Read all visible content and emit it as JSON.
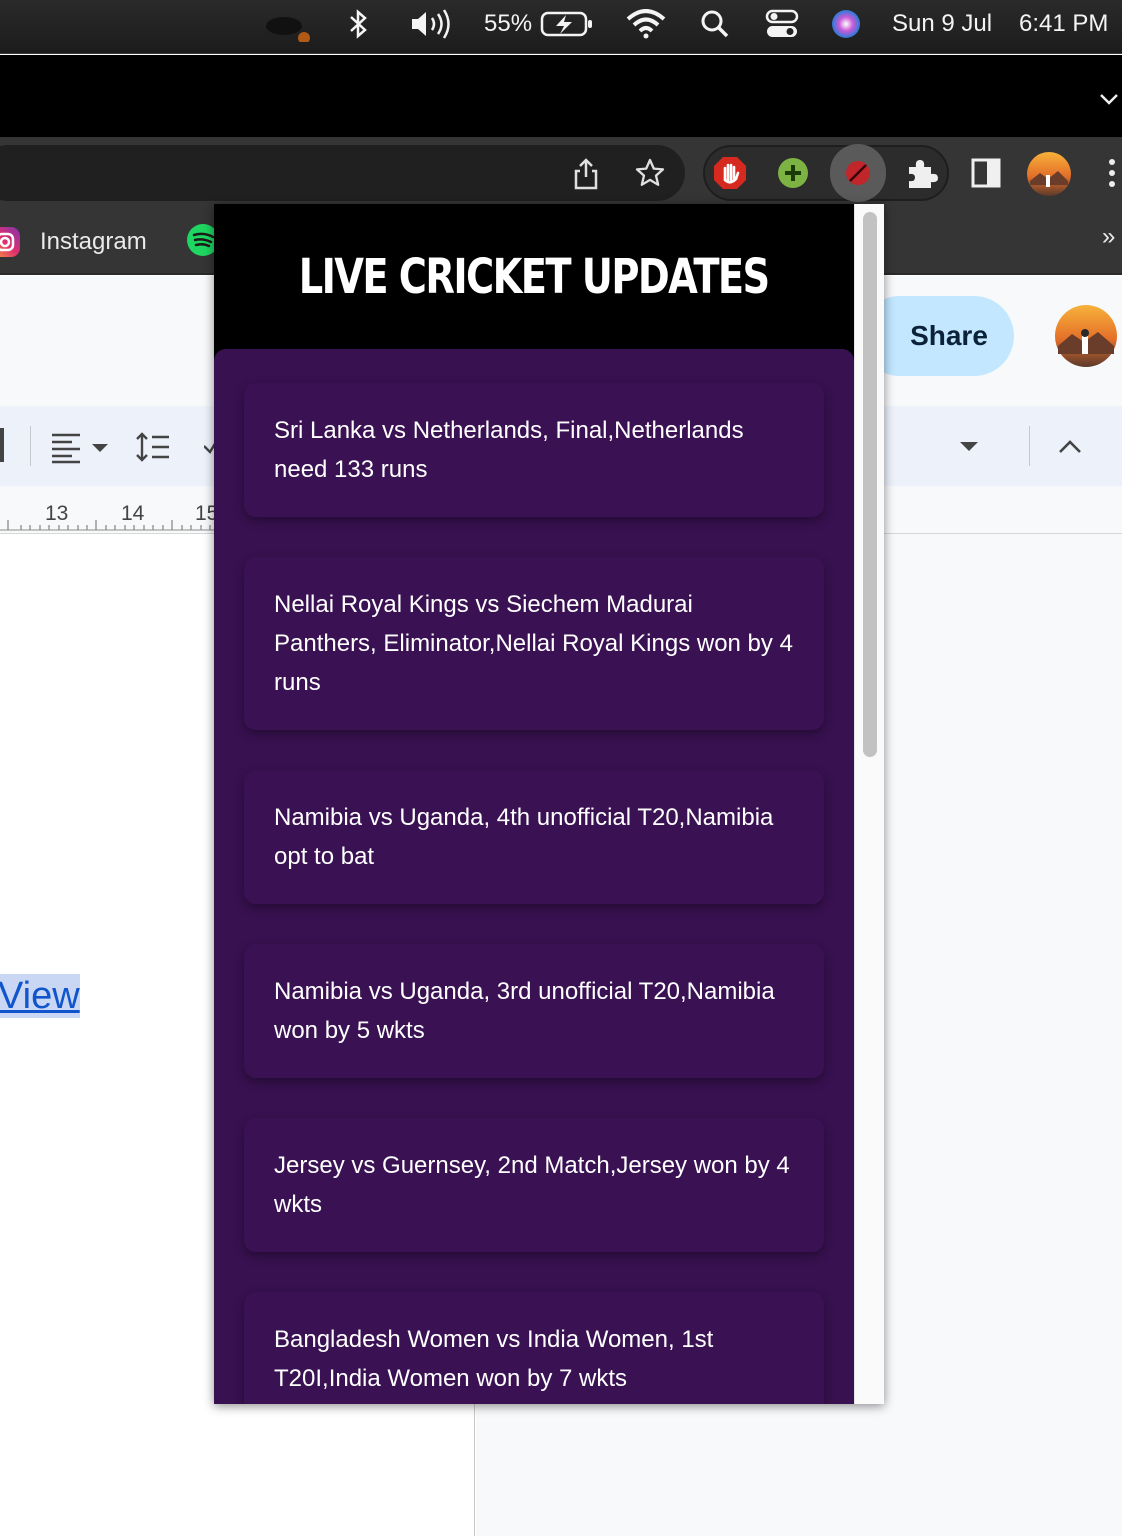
{
  "menubar": {
    "battery": "55%",
    "date": "Sun 9 Jul",
    "time": "6:41 PM"
  },
  "bookmarks": {
    "instagram": "Instagram",
    "overflow": "»"
  },
  "docs": {
    "share_label": "Share",
    "ruler_marks": [
      "13",
      "14",
      "15"
    ],
    "link_text": "View"
  },
  "popup": {
    "title": "LIVE CRICKET UPDATES",
    "updates": [
      "Sri Lanka vs Netherlands, Final,Netherlands need 133 runs",
      "Nellai Royal Kings vs Siechem Madurai Panthers, Eliminator,Nellai Royal Kings won by 4 runs",
      "Namibia vs Uganda, 4th unofficial T20,Namibia opt to bat",
      "Namibia vs Uganda, 3rd unofficial T20,Namibia won by 5 wkts",
      "Jersey vs Guernsey, 2nd Match,Jersey won by 4 wkts",
      "Bangladesh Women vs India Women, 1st T20I,India Women won by 7 wkts"
    ]
  },
  "colors": {
    "popup_bg": "#381150",
    "card_bg": "#3a1253",
    "header_bg": "#000000",
    "share_bg": "#c2e7ff"
  }
}
